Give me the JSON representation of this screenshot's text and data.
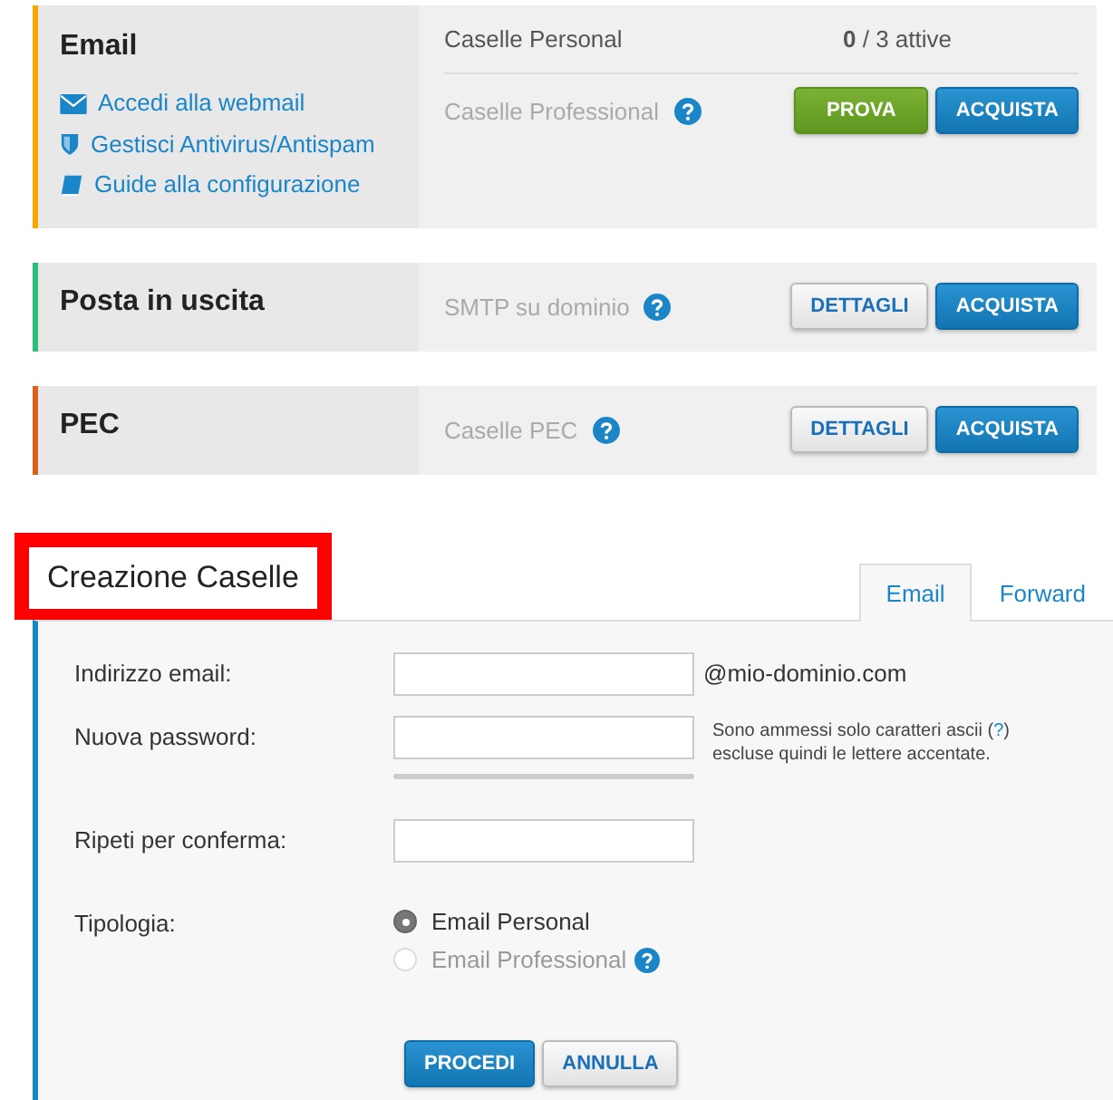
{
  "services": [
    {
      "title": "Email",
      "color": "#f5a700",
      "links": [
        {
          "kind": "envelope",
          "label": "Accedi alla webmail"
        },
        {
          "kind": "shield",
          "label": "Gestisci Antivirus/Antispam"
        },
        {
          "kind": "book",
          "label": "Guide alla configurazione"
        }
      ],
      "rows": [
        {
          "label": "Caselle Personal",
          "muted": false,
          "help": false,
          "count": "**0** / 3 attive",
          "buttons": []
        },
        {
          "label": "Caselle Professional",
          "muted": true,
          "help": true,
          "buttons": [
            {
              "label": "PROVA",
              "kind": "success"
            },
            {
              "label": "ACQUISTA",
              "kind": "primary"
            }
          ]
        }
      ]
    },
    {
      "title": "Posta in uscita",
      "color": "#2dbf7a",
      "rows": [
        {
          "label": "SMTP su dominio",
          "muted": true,
          "help": true,
          "buttons": [
            {
              "label": "DETTAGLI",
              "kind": "default"
            },
            {
              "label": "ACQUISTA",
              "kind": "primary"
            }
          ]
        }
      ]
    },
    {
      "title": "PEC",
      "color": "#d9621a",
      "rows": [
        {
          "label": "Caselle PEC",
          "muted": true,
          "help": true,
          "buttons": [
            {
              "label": "DETTAGLI",
              "kind": "default"
            },
            {
              "label": "ACQUISTA",
              "kind": "primary"
            }
          ]
        }
      ]
    }
  ],
  "creation": {
    "title": "Creazione Caselle",
    "highlighted": true,
    "tabs": [
      {
        "label": "Email",
        "selected": true
      },
      {
        "label": "Forward",
        "selected": false
      }
    ],
    "fields": [
      {
        "kind": "text",
        "label": "Indirizzo email:",
        "suffix": "@mio-dominio.com"
      },
      {
        "kind": "password-meter",
        "label": "Nuova password:",
        "hint": {
          "before": "Sono ammessi solo caratteri ascii (",
          "link": "?",
          "after": ")",
          "line2": "escluse quindi le lettere accentate."
        }
      },
      {
        "kind": "password",
        "label": "Ripeti per conferma:"
      }
    ],
    "type_label": "Tipologia:",
    "options": [
      {
        "label": "Email Personal",
        "selected": true,
        "disabled": false,
        "help": false
      },
      {
        "label": "Email Professional",
        "selected": false,
        "disabled": true,
        "help": true
      }
    ],
    "buttons": [
      {
        "label": "PROCEDI",
        "kind": "primary"
      },
      {
        "label": "ANNULLA",
        "kind": "default"
      }
    ]
  }
}
